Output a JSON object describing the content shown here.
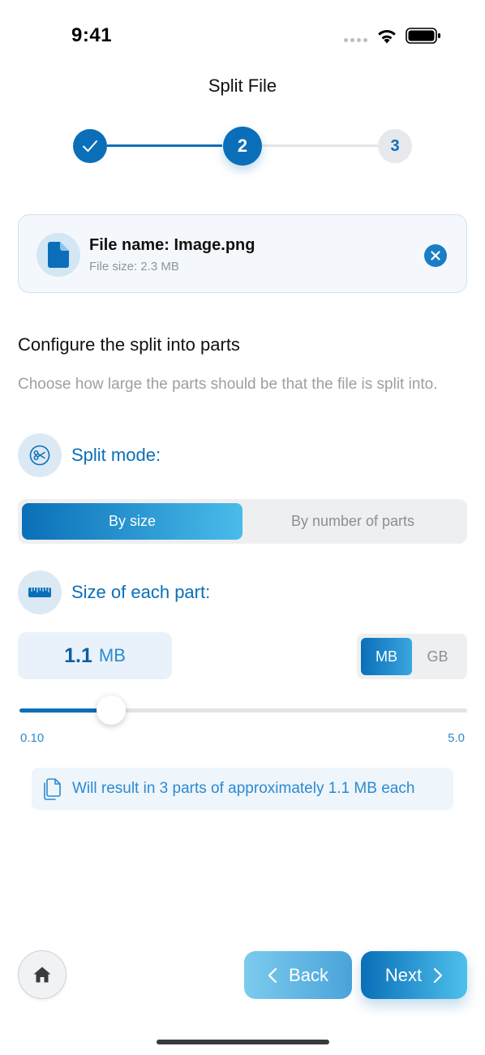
{
  "status_bar": {
    "time": "9:41"
  },
  "header": {
    "title": "Split File"
  },
  "stepper": {
    "steps": [
      {
        "label": "",
        "state": "completed"
      },
      {
        "label": "2",
        "state": "current"
      },
      {
        "label": "3",
        "state": "upcoming"
      }
    ]
  },
  "file": {
    "name_text": "File name: Image.png",
    "size_text": "File size: 2.3 MB"
  },
  "config": {
    "title": "Configure the split into parts",
    "description": "Choose how large the parts should be that the file is split into.",
    "split_mode_label": "Split mode:",
    "split_mode_options": [
      "By size",
      "By number of parts"
    ],
    "split_mode_selected": "By size",
    "size_label": "Size of each part:",
    "size_value": "1.1",
    "size_unit": "MB",
    "unit_options": [
      "MB",
      "GB"
    ],
    "unit_selected": "MB",
    "slider": {
      "min_label": "0.10",
      "max_label": "5.0",
      "min": 0.1,
      "max": 5.0,
      "value": 1.1
    },
    "result_text": "Will result in 3 parts of approximately 1.1 MB each"
  },
  "footer": {
    "back_label": "Back",
    "next_label": "Next"
  },
  "colors": {
    "accent": "#0a6fb8",
    "accent_light": "#49bcea",
    "muted_text": "#9aa0a6"
  },
  "icons": {
    "status": [
      "signal-icon",
      "wifi-icon",
      "battery-icon"
    ],
    "step_completed": "checkmark-icon",
    "file": "document-icon",
    "remove": "close-icon",
    "split_mode": "scissors-icon",
    "size": "ruler-icon",
    "result": "copy-files-icon",
    "home": "home-icon",
    "back": "chevron-left-icon",
    "next": "chevron-right-icon"
  }
}
